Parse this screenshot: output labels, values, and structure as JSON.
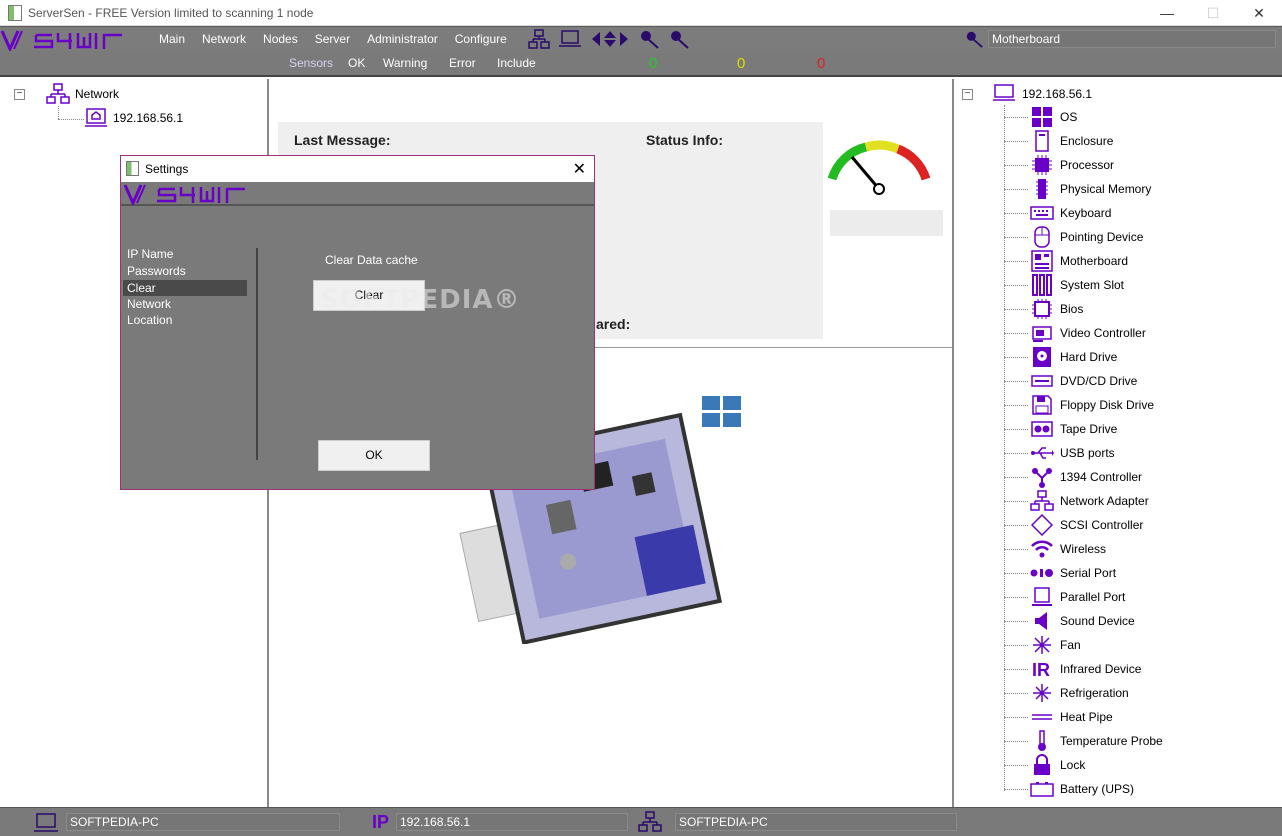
{
  "window": {
    "title": "ServerSen - FREE Version limited to scanning 1 node",
    "min": "—",
    "max": "☐",
    "close": "✕"
  },
  "menu": {
    "items": [
      "Main",
      "Network",
      "Nodes",
      "Server",
      "Administrator",
      "Configure"
    ],
    "search_value": "Motherboard"
  },
  "subbar": {
    "tabs": [
      "Sensors",
      "OK",
      "Warning",
      "Error",
      "Include"
    ],
    "ok_count": "0",
    "warning_count": "0",
    "error_count": "0"
  },
  "left_tree": {
    "root": "Network",
    "child": "192.168.56.1"
  },
  "center": {
    "last_message_label": "Last Message:",
    "status_info_label": "Status Info:",
    "partial_label": "ared:"
  },
  "right_tree": {
    "root": "192.168.56.1",
    "items": [
      "OS",
      "Enclosure",
      "Processor",
      "Physical Memory",
      "Keyboard",
      "Pointing Device",
      "Motherboard",
      "System Slot",
      "Bios",
      "Video Controller",
      "Hard Drive",
      "DVD/CD Drive",
      "Floppy Disk Drive",
      "Tape Drive",
      "USB ports",
      "1394 Controller",
      "Network Adapter",
      "SCSI Controller",
      "Wireless",
      "Serial Port",
      "Parallel Port",
      "Sound Device",
      "Fan",
      "Infrared Device",
      "Refrigeration",
      "Heat Pipe",
      "Temperature Probe",
      "Lock",
      "Battery (UPS)"
    ],
    "icons": [
      "windows-icon",
      "enclosure-icon",
      "processor-icon",
      "memory-icon",
      "keyboard-icon",
      "mouse-icon",
      "motherboard-icon",
      "slot-icon",
      "bios-icon",
      "video-icon",
      "harddrive-icon",
      "dvd-icon",
      "floppy-icon",
      "tape-icon",
      "usb-icon",
      "firewire-icon",
      "network-icon",
      "scsi-icon",
      "wifi-icon",
      "serial-icon",
      "parallel-icon",
      "speaker-icon",
      "fan-icon",
      "infrared-icon",
      "snowflake-icon",
      "heatpipe-icon",
      "thermometer-icon",
      "lock-icon",
      "battery-icon"
    ]
  },
  "statusbar": {
    "computer": "SOFTPEDIA-PC",
    "ip_label": "IP",
    "ip": "192.168.56.1",
    "network": "SOFTPEDIA-PC"
  },
  "dialog": {
    "title": "Settings",
    "close": "✕",
    "nav": [
      "IP Name",
      "Passwords",
      "Clear",
      "Network",
      "Location"
    ],
    "selected_nav": "Clear",
    "clear_label": "Clear Data cache",
    "clear_button": "Clear",
    "ok_button": "OK",
    "watermark": "SOFTPEDIA®"
  },
  "colors": {
    "brand_purple": "#6a00c8",
    "toolbar_gray": "#7a7a7a",
    "ok_green": "#22cc22",
    "warn_yellow": "#dddd00",
    "err_red": "#dd2222"
  }
}
